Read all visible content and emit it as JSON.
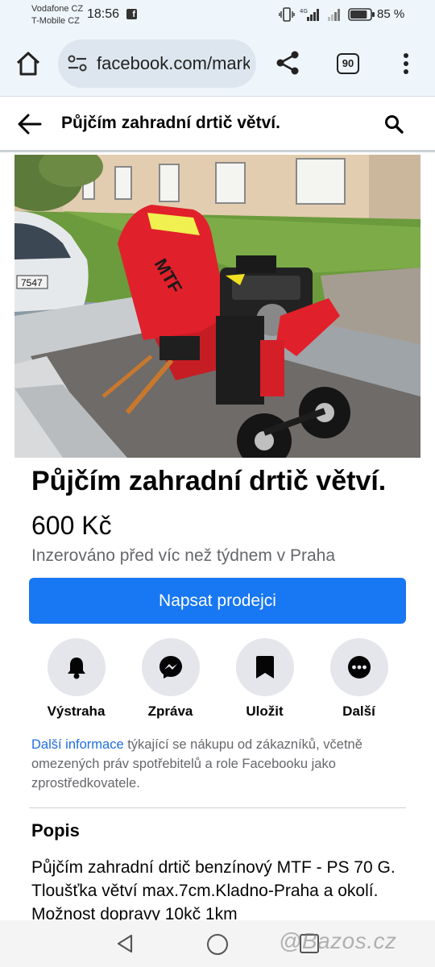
{
  "status_bar": {
    "carrier_1": "Vodafone CZ",
    "carrier_2": "T-Mobile CZ",
    "time": "18:56",
    "network_label": "4G",
    "battery_percent": "85 %",
    "battery_level": 0.85,
    "icons": [
      "facebook-notification-icon",
      "vibrate-icon",
      "signal-icon",
      "signal-icon",
      "battery-icon"
    ]
  },
  "browser": {
    "url": "facebook.com/marketplace",
    "tab_count": "90",
    "icons": [
      "home-icon",
      "site-settings-icon",
      "share-icon",
      "more-vert-icon"
    ]
  },
  "header": {
    "title": "Půjčím zahradní drtič větví.",
    "icons": [
      "arrow-back-icon",
      "search-icon"
    ]
  },
  "listing": {
    "photo_description": "red MTF garden branch chipper on a trailer",
    "title": "Půjčím zahradní drtič větví.",
    "price": "600 Kč",
    "posted": "Inzerováno před víc než týdnem v Praha",
    "message_button": "Napsat prodejci"
  },
  "actions": [
    {
      "label": "Výstraha",
      "icon": "bell-icon"
    },
    {
      "label": "Zpráva",
      "icon": "messenger-icon"
    },
    {
      "label": "Uložit",
      "icon": "bookmark-icon"
    },
    {
      "label": "Další",
      "icon": "more-horiz-icon"
    }
  ],
  "disclaimer": {
    "link": "Další informace",
    "text": " týkající se nákupu od zákazníků, včetně omezených práv spotřebitelů a role Facebooku jako zprostředkovatele."
  },
  "description": {
    "heading": "Popis",
    "text": "Půjčím zahradní drtič benzínový MTF - PS 70 G. Tloušťka větví max.7cm.Kladno-Praha a okolí. Možnost dopravy 10kč 1km"
  },
  "photo_text": {
    "license_plate": "7547",
    "brand": "MTF"
  },
  "watermark": "@Bazos.cz",
  "colors": {
    "accent": "#1877f2",
    "link": "#216fdb",
    "secondary_text": "#65676b",
    "chipper_red": "#e0202a",
    "browser_bg": "#eef5fb"
  }
}
